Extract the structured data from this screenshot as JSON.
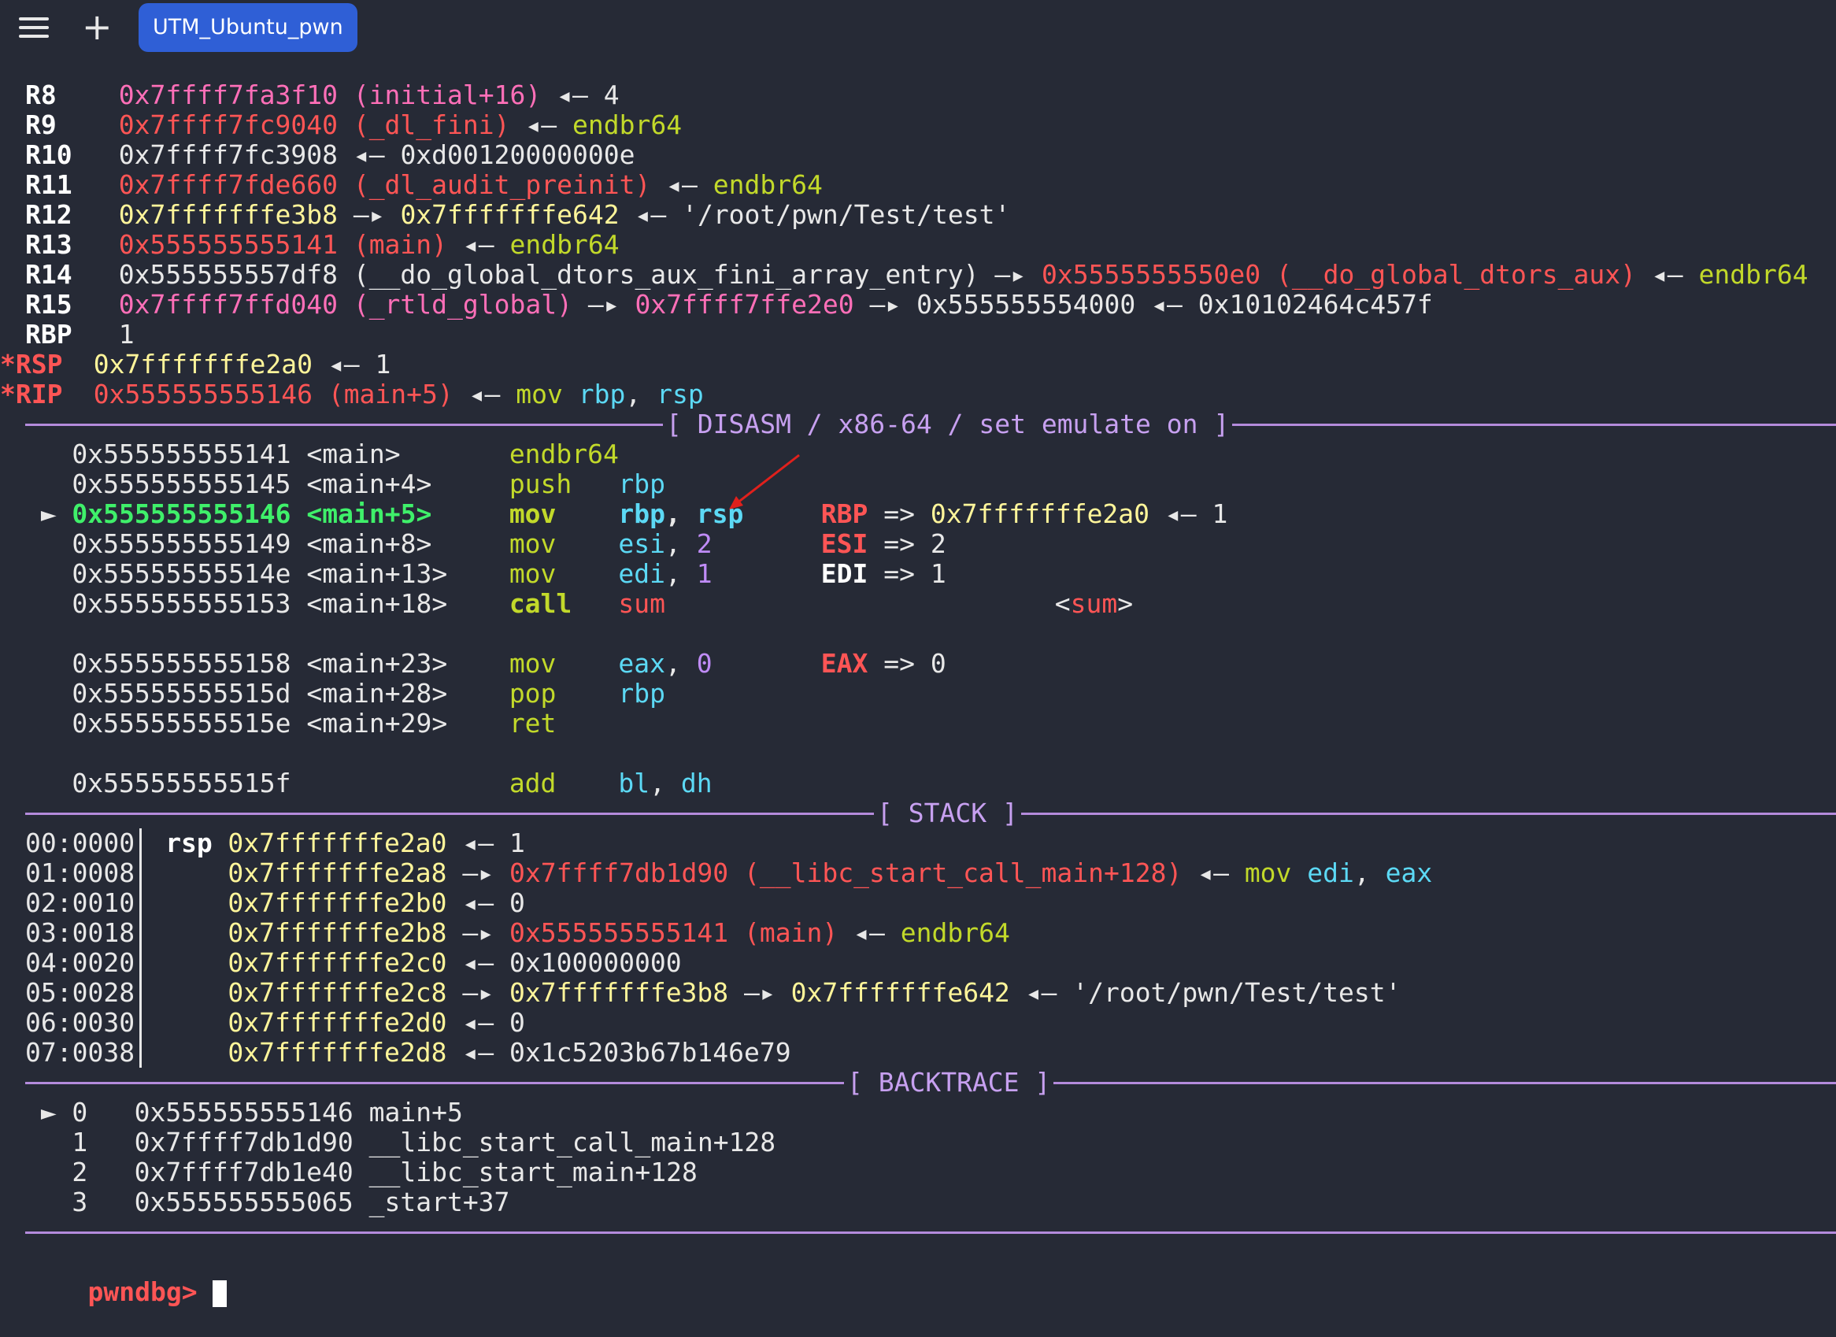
{
  "window": {
    "tab_label": "UTM_Ubuntu_pwn"
  },
  "registers": [
    {
      "mark": " ",
      "name": "R8",
      "value": "0x7ffff7fa3f10",
      "rest": [
        {
          "t": " (initial+16)",
          "c": "pink"
        },
        {
          "t": " ◂— ",
          "c": "white"
        },
        {
          "t": "4",
          "c": "white"
        }
      ],
      "vcolor": "pink"
    },
    {
      "mark": " ",
      "name": "R9",
      "value": "0x7ffff7fc9040",
      "rest": [
        {
          "t": " (_dl_fini)",
          "c": "red"
        },
        {
          "t": " ◂— ",
          "c": "white"
        },
        {
          "t": "endbr64",
          "c": "grn"
        }
      ],
      "vcolor": "red"
    },
    {
      "mark": " ",
      "name": "R10",
      "value": "0x7ffff7fc3908",
      "rest": [
        {
          "t": " ◂— ",
          "c": "white"
        },
        {
          "t": "0xd00120000000e",
          "c": "white"
        }
      ],
      "vcolor": "white"
    },
    {
      "mark": " ",
      "name": "R11",
      "value": "0x7ffff7fde660",
      "rest": [
        {
          "t": " (_dl_audit_preinit)",
          "c": "red"
        },
        {
          "t": " ◂— ",
          "c": "white"
        },
        {
          "t": "endbr64",
          "c": "grn"
        }
      ],
      "vcolor": "red"
    },
    {
      "mark": " ",
      "name": "R12",
      "value": "0x7fffffffe3b8",
      "rest": [
        {
          "t": " —▸ ",
          "c": "white"
        },
        {
          "t": "0x7fffffffe642",
          "c": "yel"
        },
        {
          "t": " ◂— ",
          "c": "white"
        },
        {
          "t": "'/root/pwn/Test/test'",
          "c": "white"
        }
      ],
      "vcolor": "yel"
    },
    {
      "mark": " ",
      "name": "R13",
      "value": "0x555555555141",
      "rest": [
        {
          "t": " (main)",
          "c": "red"
        },
        {
          "t": " ◂— ",
          "c": "white"
        },
        {
          "t": "endbr64",
          "c": "grn"
        }
      ],
      "vcolor": "red"
    },
    {
      "mark": " ",
      "name": "R14",
      "value": "0x555555557df8",
      "rest": [
        {
          "t": " (__do_global_dtors_aux_fini_array_entry)",
          "c": "white"
        },
        {
          "t": " —▸ ",
          "c": "white"
        },
        {
          "t": "0x5555555550e0 (__do_global_dtors_aux)",
          "c": "red"
        },
        {
          "t": " ◂— ",
          "c": "white"
        },
        {
          "t": "endbr64",
          "c": "grn"
        }
      ],
      "vcolor": "white"
    },
    {
      "mark": " ",
      "name": "R15",
      "value": "0x7ffff7ffd040",
      "rest": [
        {
          "t": " (_rtld_global)",
          "c": "pink"
        },
        {
          "t": " —▸ ",
          "c": "white"
        },
        {
          "t": "0x7ffff7ffe2e0",
          "c": "pink"
        },
        {
          "t": " —▸ ",
          "c": "white"
        },
        {
          "t": "0x555555554000",
          "c": "white"
        },
        {
          "t": " ◂— ",
          "c": "white"
        },
        {
          "t": "0x10102464c457f",
          "c": "white"
        }
      ],
      "vcolor": "pink"
    },
    {
      "mark": " ",
      "name": "RBP",
      "value": "1",
      "rest": [],
      "vcolor": "white"
    },
    {
      "mark": "*",
      "name": "RSP",
      "value": "0x7fffffffe2a0",
      "rest": [
        {
          "t": " ◂— ",
          "c": "white"
        },
        {
          "t": "1",
          "c": "white"
        }
      ],
      "vcolor": "yel"
    },
    {
      "mark": "*",
      "name": "RIP",
      "value": "0x555555555146",
      "rest": [
        {
          "t": " (main+5)",
          "c": "red"
        },
        {
          "t": " ◂— ",
          "c": "white"
        },
        {
          "t": "mov",
          "c": "grn"
        },
        {
          "t": " ",
          "c": "white"
        },
        {
          "t": "rbp",
          "c": "cyan"
        },
        {
          "t": ", ",
          "c": "white"
        },
        {
          "t": "rsp",
          "c": "cyan"
        }
      ],
      "vcolor": "red"
    }
  ],
  "sections": {
    "disasm": "[ DISASM / x86-64 / set emulate on ]",
    "stack": "[ STACK ]",
    "backtrace": "[ BACKTRACE ]"
  },
  "disasm": [
    {
      "cur": false,
      "addr": "0x555555555141",
      "sym": "<main>",
      "mn": "endbr64",
      "ops": [],
      "emu": []
    },
    {
      "cur": false,
      "addr": "0x555555555145",
      "sym": "<main+4>",
      "mn": "push",
      "ops": [
        {
          "t": "rbp",
          "c": "cyan"
        }
      ],
      "emu": []
    },
    {
      "cur": true,
      "addr": "0x555555555146",
      "sym": "<main+5>",
      "mn": "mov",
      "ops": [
        {
          "t": "rbp",
          "c": "cyan"
        },
        {
          "t": ", ",
          "c": "white"
        },
        {
          "t": "rsp",
          "c": "cyan"
        }
      ],
      "emu": [
        {
          "t": "RBP",
          "c": "regm"
        },
        {
          "t": " => ",
          "c": "white"
        },
        {
          "t": "0x7fffffffe2a0",
          "c": "yel"
        },
        {
          "t": " ◂— ",
          "c": "white"
        },
        {
          "t": "1",
          "c": "white"
        }
      ]
    },
    {
      "cur": false,
      "addr": "0x555555555149",
      "sym": "<main+8>",
      "mn": "mov",
      "ops": [
        {
          "t": "esi",
          "c": "cyan"
        },
        {
          "t": ", ",
          "c": "white"
        },
        {
          "t": "2",
          "c": "purp"
        }
      ],
      "emu": [
        {
          "t": "ESI",
          "c": "regm"
        },
        {
          "t": " => ",
          "c": "white"
        },
        {
          "t": "2",
          "c": "white"
        }
      ]
    },
    {
      "cur": false,
      "addr": "0x55555555514e",
      "sym": "<main+13>",
      "mn": "mov",
      "ops": [
        {
          "t": "edi",
          "c": "cyan"
        },
        {
          "t": ", ",
          "c": "white"
        },
        {
          "t": "1",
          "c": "purp"
        }
      ],
      "emu": [
        {
          "t": "EDI",
          "c": "reg"
        },
        {
          "t": " => ",
          "c": "white"
        },
        {
          "t": "1",
          "c": "white"
        }
      ]
    },
    {
      "cur": false,
      "call": true,
      "addr": "0x555555555153",
      "sym": "<main+18>",
      "mn": "call",
      "ops": [
        {
          "t": "sum",
          "c": "red"
        }
      ],
      "emu": [],
      "target": "sum"
    },
    {
      "blank": true
    },
    {
      "cur": false,
      "addr": "0x555555555158",
      "sym": "<main+23>",
      "mn": "mov",
      "ops": [
        {
          "t": "eax",
          "c": "cyan"
        },
        {
          "t": ", ",
          "c": "white"
        },
        {
          "t": "0",
          "c": "purp"
        }
      ],
      "emu": [
        {
          "t": "EAX",
          "c": "regm"
        },
        {
          "t": " => ",
          "c": "white"
        },
        {
          "t": "0",
          "c": "white"
        }
      ]
    },
    {
      "cur": false,
      "addr": "0x55555555515d",
      "sym": "<main+28>",
      "mn": "pop",
      "ops": [
        {
          "t": "rbp",
          "c": "cyan"
        }
      ],
      "emu": []
    },
    {
      "cur": false,
      "addr": "0x55555555515e",
      "sym": "<main+29>",
      "mn": "ret",
      "ops": [],
      "emu": []
    },
    {
      "blank": true
    },
    {
      "cur": false,
      "addr": "0x55555555515f",
      "sym": "",
      "mn": "add",
      "ops": [
        {
          "t": "bl",
          "c": "cyan"
        },
        {
          "t": ", ",
          "c": "white"
        },
        {
          "t": "dh",
          "c": "cyan"
        }
      ],
      "emu": []
    }
  ],
  "stack": [
    {
      "idx": "00:0000",
      "reg": "rsp",
      "addr": "0x7fffffffe2a0",
      "rest": [
        {
          "t": " ◂— ",
          "c": "white"
        },
        {
          "t": "1",
          "c": "white"
        }
      ]
    },
    {
      "idx": "01:0008",
      "reg": "",
      "addr": "0x7fffffffe2a8",
      "rest": [
        {
          "t": " —▸ ",
          "c": "white"
        },
        {
          "t": "0x7ffff7db1d90 (__libc_start_call_main+128)",
          "c": "red"
        },
        {
          "t": " ◂— ",
          "c": "white"
        },
        {
          "t": "mov",
          "c": "grn"
        },
        {
          "t": " ",
          "c": "white"
        },
        {
          "t": "edi",
          "c": "cyan"
        },
        {
          "t": ", ",
          "c": "white"
        },
        {
          "t": "eax",
          "c": "cyan"
        }
      ]
    },
    {
      "idx": "02:0010",
      "reg": "",
      "addr": "0x7fffffffe2b0",
      "rest": [
        {
          "t": " ◂— ",
          "c": "white"
        },
        {
          "t": "0",
          "c": "white"
        }
      ]
    },
    {
      "idx": "03:0018",
      "reg": "",
      "addr": "0x7fffffffe2b8",
      "rest": [
        {
          "t": " —▸ ",
          "c": "white"
        },
        {
          "t": "0x555555555141 (main)",
          "c": "red"
        },
        {
          "t": " ◂— ",
          "c": "white"
        },
        {
          "t": "endbr64",
          "c": "grn"
        }
      ]
    },
    {
      "idx": "04:0020",
      "reg": "",
      "addr": "0x7fffffffe2c0",
      "rest": [
        {
          "t": " ◂— ",
          "c": "white"
        },
        {
          "t": "0x100000000",
          "c": "white"
        }
      ]
    },
    {
      "idx": "05:0028",
      "reg": "",
      "addr": "0x7fffffffe2c8",
      "rest": [
        {
          "t": " —▸ ",
          "c": "white"
        },
        {
          "t": "0x7fffffffe3b8",
          "c": "yel"
        },
        {
          "t": " —▸ ",
          "c": "white"
        },
        {
          "t": "0x7fffffffe642",
          "c": "yel"
        },
        {
          "t": " ◂— ",
          "c": "white"
        },
        {
          "t": "'/root/pwn/Test/test'",
          "c": "white"
        }
      ]
    },
    {
      "idx": "06:0030",
      "reg": "",
      "addr": "0x7fffffffe2d0",
      "rest": [
        {
          "t": " ◂— ",
          "c": "white"
        },
        {
          "t": "0",
          "c": "white"
        }
      ]
    },
    {
      "idx": "07:0038",
      "reg": "",
      "addr": "0x7fffffffe2d8",
      "rest": [
        {
          "t": " ◂— ",
          "c": "white"
        },
        {
          "t": "0x1c5203b67b146e79",
          "c": "white"
        }
      ]
    }
  ],
  "backtrace": [
    {
      "cur": true,
      "n": "0",
      "addr": "0x555555555146",
      "sym": "main+5"
    },
    {
      "cur": false,
      "n": "1",
      "addr": "0x7ffff7db1d90",
      "sym": "__libc_start_call_main+128"
    },
    {
      "cur": false,
      "n": "2",
      "addr": "0x7ffff7db1e40",
      "sym": "__libc_start_main+128"
    },
    {
      "cur": false,
      "n": "3",
      "addr": "0x555555555065",
      "sym": "_start+37"
    }
  ],
  "prompt": "pwndbg> ",
  "colors": {
    "background": "#262a36",
    "tab": "#2f5fd6",
    "separator": "#b48bdc",
    "pink": "#ff6fb8",
    "red": "#ff5555",
    "yellow": "#fff59a",
    "green": "#c2d92a",
    "cyan": "#5cd9f5",
    "purple": "#c08cf7",
    "current": "#3ff06a"
  }
}
